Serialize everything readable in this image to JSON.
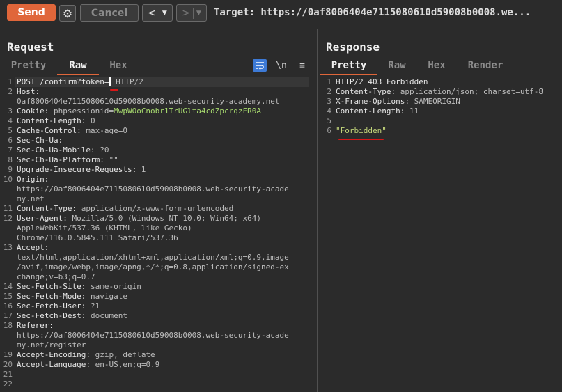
{
  "toolbar": {
    "send_label": "Send",
    "cancel_label": "Cancel",
    "prev_label": "<",
    "next_label": ">",
    "dropdown_glyph": "▼",
    "target_text": "Target: https://0af8006404e7115080610d59008b0008.we..."
  },
  "request": {
    "title": "Request",
    "tabs": [
      "Pretty",
      "Raw",
      "Hex"
    ],
    "active_tab": "Raw",
    "newline_toggle": "\\n",
    "lines": [
      {
        "n": "1",
        "key": "POST /confirm?token=",
        "val": " HTTP/2"
      },
      {
        "n": "2",
        "key": "Host:",
        "val": ""
      },
      {
        "n": "",
        "key": "",
        "val": "0af8006404e7115080610d59008b0008.web-security-academy.net"
      },
      {
        "n": "3",
        "key": "Cookie: ",
        "val": "phpsessionid=",
        "sess": "MwpWOoCnobr1TrUGlta4cdZpcrqzFR0A"
      },
      {
        "n": "4",
        "key": "Content-Length:",
        "val": " 0"
      },
      {
        "n": "5",
        "key": "Cache-Control:",
        "val": " max-age=0"
      },
      {
        "n": "6",
        "key": "Sec-Ch-Ua:",
        "val": ""
      },
      {
        "n": "7",
        "key": "Sec-Ch-Ua-Mobile:",
        "val": " ?0"
      },
      {
        "n": "8",
        "key": "Sec-Ch-Ua-Platform:",
        "val": " \"\""
      },
      {
        "n": "9",
        "key": "Upgrade-Insecure-Requests:",
        "val": " 1"
      },
      {
        "n": "10",
        "key": "Origin:",
        "val": ""
      },
      {
        "n": "",
        "key": "",
        "val": "https://0af8006404e7115080610d59008b0008.web-security-acade"
      },
      {
        "n": "",
        "key": "",
        "val": "my.net"
      },
      {
        "n": "11",
        "key": "Content-Type:",
        "val": " application/x-www-form-urlencoded"
      },
      {
        "n": "12",
        "key": "User-Agent:",
        "val": " Mozilla/5.0 (Windows NT 10.0; Win64; x64)"
      },
      {
        "n": "",
        "key": "",
        "val": "AppleWebKit/537.36 (KHTML, like Gecko)"
      },
      {
        "n": "",
        "key": "",
        "val": "Chrome/116.0.5845.111 Safari/537.36"
      },
      {
        "n": "13",
        "key": "Accept:",
        "val": ""
      },
      {
        "n": "",
        "key": "",
        "val": "text/html,application/xhtml+xml,application/xml;q=0.9,image"
      },
      {
        "n": "",
        "key": "",
        "val": "/avif,image/webp,image/apng,*/*;q=0.8,application/signed-ex"
      },
      {
        "n": "",
        "key": "",
        "val": "change;v=b3;q=0.7"
      },
      {
        "n": "14",
        "key": "Sec-Fetch-Site:",
        "val": " same-origin"
      },
      {
        "n": "15",
        "key": "Sec-Fetch-Mode:",
        "val": " navigate"
      },
      {
        "n": "16",
        "key": "Sec-Fetch-User:",
        "val": " ?1"
      },
      {
        "n": "17",
        "key": "Sec-Fetch-Dest:",
        "val": " document"
      },
      {
        "n": "18",
        "key": "Referer:",
        "val": ""
      },
      {
        "n": "",
        "key": "",
        "val": "https://0af8006404e7115080610d59008b0008.web-security-acade"
      },
      {
        "n": "",
        "key": "",
        "val": "my.net/register"
      },
      {
        "n": "19",
        "key": "Accept-Encoding:",
        "val": " gzip, deflate"
      },
      {
        "n": "20",
        "key": "Accept-Language:",
        "val": " en-US,en;q=0.9"
      },
      {
        "n": "21",
        "key": "",
        "val": ""
      },
      {
        "n": "22",
        "key": "",
        "val": ""
      }
    ]
  },
  "response": {
    "title": "Response",
    "tabs": [
      "Pretty",
      "Raw",
      "Hex",
      "Render"
    ],
    "active_tab": "Pretty",
    "lines": [
      {
        "n": "1",
        "key": "HTTP/2 403 Forbidden",
        "val": ""
      },
      {
        "n": "2",
        "key": "Content-Type:",
        "val": " application/json; charset=utf-8"
      },
      {
        "n": "3",
        "key": "X-Frame-Options:",
        "val": " SAMEORIGIN"
      },
      {
        "n": "4",
        "key": "Content-Length:",
        "val": " 11"
      },
      {
        "n": "5",
        "key": "",
        "val": ""
      },
      {
        "n": "6",
        "key": "",
        "val": "",
        "str": "\"Forbidden\""
      }
    ]
  },
  "colors": {
    "accent": "#e0663a",
    "annotation": "#d81818"
  }
}
